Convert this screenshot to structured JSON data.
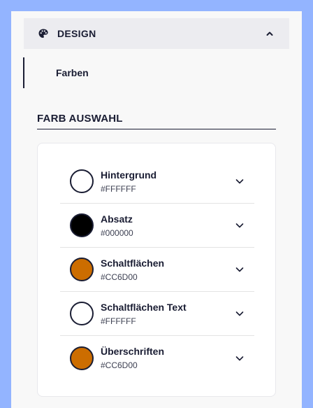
{
  "section": {
    "title": "DESIGN",
    "icon": "palette-icon",
    "toggle_icon": "chevron-up-icon"
  },
  "nav": {
    "active_item": "Farben"
  },
  "color_picker": {
    "heading": "FARB AUSWAHL",
    "items": [
      {
        "name": "Hintergrund",
        "hex": "#FFFFFF",
        "swatch": "#ffffff"
      },
      {
        "name": "Absatz",
        "hex": "#000000",
        "swatch": "#000000"
      },
      {
        "name": "Schaltflächen",
        "hex": "#CC6D00",
        "swatch": "#cc6d00"
      },
      {
        "name": "Schaltflächen Text",
        "hex": "#FFFFFF",
        "swatch": "#ffffff"
      },
      {
        "name": "Überschriften",
        "hex": "#CC6D00",
        "swatch": "#cc6d00"
      }
    ]
  },
  "colors": {
    "page_background": "#93b4ff",
    "panel_background": "#f8f8f8",
    "header_background": "#ececf0",
    "text_dark": "#1a1d33"
  }
}
